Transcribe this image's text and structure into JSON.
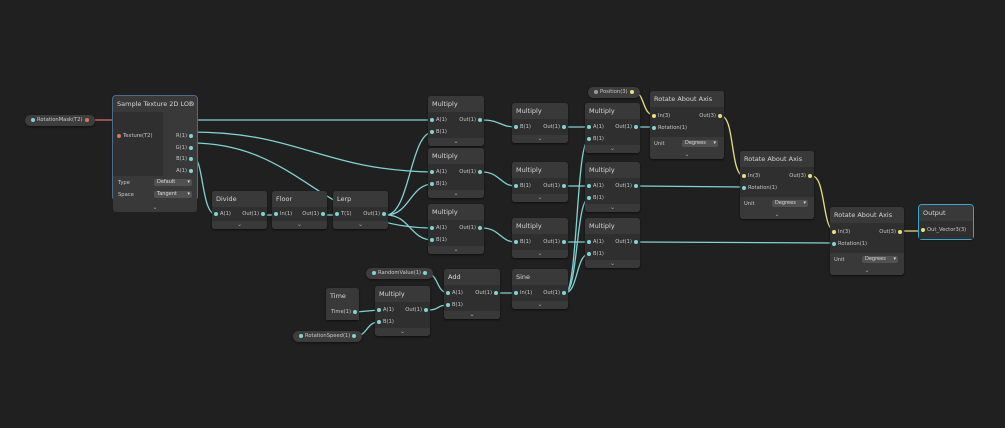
{
  "nodes": {
    "sample_texture": {
      "title": "Sample Texture 2D LOD",
      "close": "x",
      "input_texture": "Texture(T2)",
      "outputs": [
        "R(1)",
        "G(1)",
        "B(1)",
        "A(1)"
      ],
      "type_label": "Type",
      "type_value": "Default",
      "space_label": "Space",
      "space_value": "Tangent"
    },
    "divide": {
      "title": "Divide",
      "in": "A(1)",
      "out": "Out(1)"
    },
    "floor": {
      "title": "Floor",
      "in": "In(1)",
      "out": "Out(1)"
    },
    "lerp": {
      "title": "Lerp",
      "in": "T(1)",
      "out": "Out(1)"
    },
    "multiply_1": {
      "title": "Multiply",
      "a": "A(1)",
      "b": "B(1)",
      "out": "Out(1)"
    },
    "multiply_2": {
      "title": "Multiply",
      "a": "A(1)",
      "b": "B(1)",
      "out": "Out(1)"
    },
    "multiply_3": {
      "title": "Multiply",
      "a": "A(1)",
      "b": "B(1)",
      "out": "Out(1)"
    },
    "multiply_4": {
      "title": "Multiply",
      "b": "B(1)",
      "out": "Out(1)"
    },
    "multiply_5": {
      "title": "Multiply",
      "b": "B(1)",
      "out": "Out(1)"
    },
    "multiply_6": {
      "title": "Multiply",
      "b": "B(1)",
      "out": "Out(1)"
    },
    "multiply_7": {
      "title": "Multiply",
      "a": "A(1)",
      "b": "B(1)",
      "out": "Out(1)"
    },
    "multiply_8": {
      "title": "Multiply",
      "a": "A(1)",
      "b": "B(1)",
      "out": "Out(1)"
    },
    "multiply_9": {
      "title": "Multiply",
      "a": "A(1)",
      "b": "B(1)",
      "out": "Out(1)"
    },
    "multiply_time": {
      "title": "Multiply",
      "a": "A(1)",
      "b": "B(1)",
      "out": "Out(1)"
    },
    "time": {
      "title": "Time",
      "out": "Time(1)"
    },
    "add": {
      "title": "Add",
      "a": "A(1)",
      "b": "B(1)",
      "out": "Out(1)"
    },
    "sine": {
      "title": "Sine",
      "in": "In(1)",
      "out": "Out(1)"
    },
    "rotate_1": {
      "title": "Rotate About Axis",
      "in": "In(3)",
      "rot": "Rotation(1)",
      "out": "Out(3)",
      "unit_label": "Unit",
      "unit_value": "Degrees"
    },
    "rotate_2": {
      "title": "Rotate About Axis",
      "in": "In(3)",
      "rot": "Rotation(1)",
      "out": "Out(3)",
      "unit_label": "Unit",
      "unit_value": "Degrees"
    },
    "rotate_3": {
      "title": "Rotate About Axis",
      "in": "In(3)",
      "rot": "Rotation(1)",
      "out": "Out(3)",
      "unit_label": "Unit",
      "unit_value": "Degrees"
    },
    "output": {
      "title": "Output",
      "in": "Out_Vector3(3)"
    }
  },
  "properties": {
    "rotation_mask": "RotationMask(T2)",
    "position": "Position(3)",
    "random_value": "RandomValue(1)",
    "rotation_speed": "RotationSpeed(1)"
  },
  "colors": {
    "float_wire": "#7fd4d4",
    "vector_wire": "#e8e07a",
    "texture_wire": "#e0705f",
    "background": "#202020"
  },
  "chevron": "⌄"
}
